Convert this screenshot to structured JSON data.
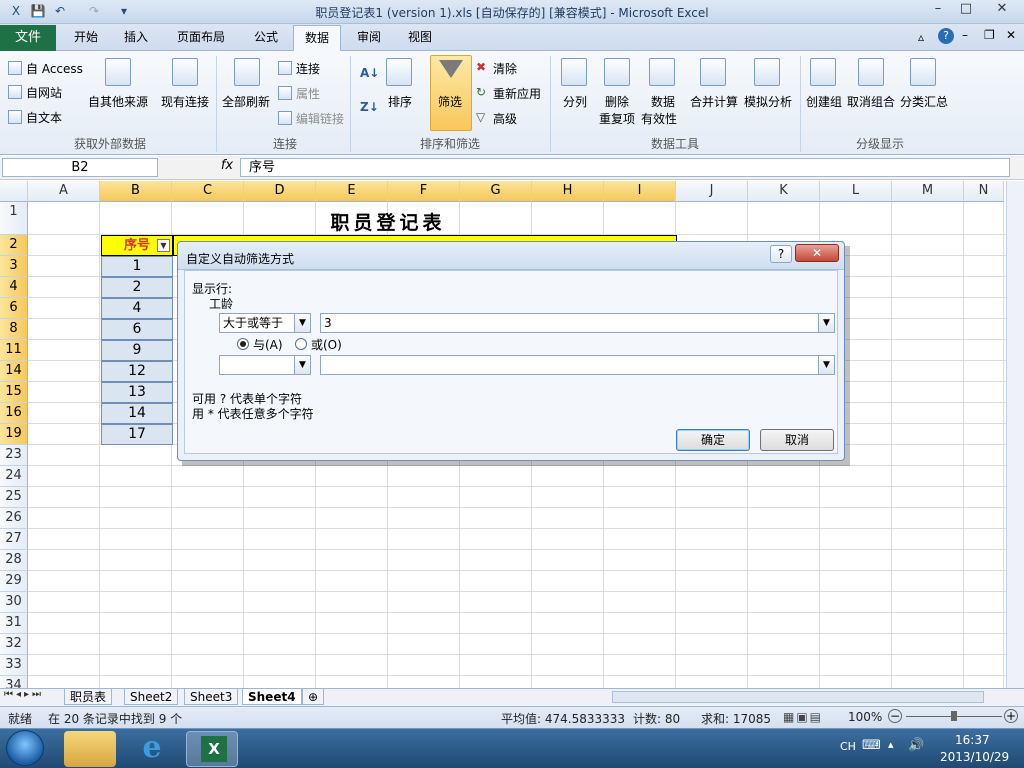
{
  "window": {
    "title": "职员登记表1 (version 1).xls [自动保存的] [兼容模式] - Microsoft Excel",
    "min": "–",
    "max": "□",
    "close": "✕"
  },
  "tabs": {
    "file": "文件",
    "items": [
      "开始",
      "插入",
      "页面布局",
      "公式",
      "数据",
      "审阅",
      "视图"
    ],
    "active": "数据"
  },
  "ribbon": {
    "get_external": {
      "access": "自 Access",
      "web": "自网站",
      "text": "自文本",
      "other": "自其他来源",
      "existing": "现有连接",
      "label": "获取外部数据"
    },
    "connections": {
      "refresh_all": "全部刷新",
      "connections": "连接",
      "properties": "属性",
      "edit_links": "编辑链接",
      "label": "连接"
    },
    "sort_filter": {
      "sort": "排序",
      "filter": "筛选",
      "clear": "清除",
      "reapply": "重新应用",
      "advanced": "高级",
      "label": "排序和筛选"
    },
    "data_tools": {
      "text_to_columns": "分列",
      "remove_dup_1": "删除",
      "remove_dup_2": "重复项",
      "validation_1": "数据",
      "validation_2": "有效性",
      "consolidate": "合并计算",
      "whatif": "模拟分析",
      "label": "数据工具"
    },
    "outline": {
      "group": "创建组",
      "ungroup": "取消组合",
      "subtotal": "分类汇总",
      "label": "分级显示"
    }
  },
  "formula_bar": {
    "name_box": "B2",
    "fx": "fx",
    "value": "序号"
  },
  "sheet": {
    "columns": [
      "A",
      "B",
      "C",
      "D",
      "E",
      "F",
      "G",
      "H",
      "I",
      "J",
      "K",
      "L",
      "M",
      "N"
    ],
    "rows": [
      "1",
      "2",
      "3",
      "4",
      "6",
      "8",
      "11",
      "14",
      "15",
      "16",
      "19",
      "23",
      "24",
      "25",
      "26",
      "27",
      "28",
      "29",
      "30",
      "31",
      "32",
      "33",
      "34"
    ],
    "title": "职员登记表",
    "header_b": "序号",
    "b_values": [
      "1",
      "2",
      "4",
      "6",
      "9",
      "12",
      "13",
      "14",
      "17"
    ]
  },
  "sheet_tabs": [
    "职员表",
    "Sheet2",
    "Sheet3",
    "Sheet4"
  ],
  "active_sheet": "Sheet4",
  "status": {
    "ready": "就绪",
    "found": "在 20 条记录中找到 9 个",
    "average": "平均值: 474.5833333",
    "count": "计数: 80",
    "sum": "求和: 17085",
    "zoom": "100%"
  },
  "dialog": {
    "title": "自定义自动筛选方式",
    "show_rows": "显示行:",
    "field": "工龄",
    "op1": "大于或等于",
    "val1": "3",
    "and": "与(A)",
    "or": "或(O)",
    "op2": "",
    "val2": "",
    "hint1": "可用 ? 代表单个字符",
    "hint2": "用 * 代表任意多个字符",
    "ok": "确定",
    "cancel": "取消",
    "help": "?"
  },
  "taskbar": {
    "lang": "CH",
    "time": "16:37",
    "date": "2013/10/29"
  },
  "colors": {
    "file_tab": "#1e7145",
    "header_yellow": "#ffff00",
    "header_text": "#d4342c",
    "selected_col": "#f6c85a"
  }
}
